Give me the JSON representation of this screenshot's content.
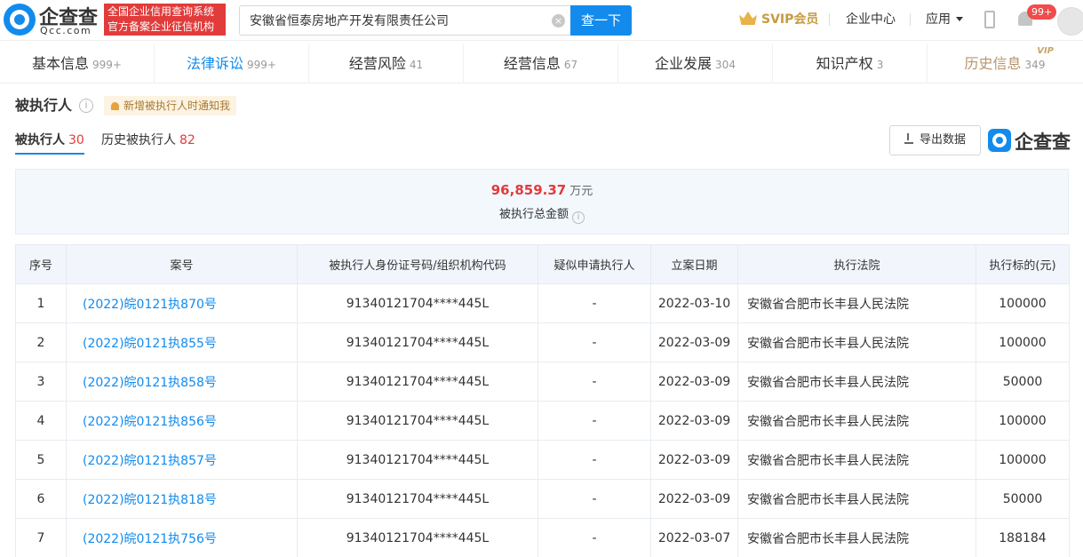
{
  "header": {
    "logo_cn": "企查查",
    "logo_en": "Qcc.com",
    "badge_line1": "全国企业信用查询系统",
    "badge_line2": "官方备案企业征信机构",
    "search_value": "安徽省恒泰房地产开发有限责任公司",
    "search_button": "查一下",
    "svip": "SVIP会员",
    "enterprise_center": "企业中心",
    "apps": "应用",
    "notification_count": "99+"
  },
  "tabs": [
    {
      "label": "基本信息",
      "count": "999+"
    },
    {
      "label": "法律诉讼",
      "count": "999+"
    },
    {
      "label": "经营风险",
      "count": "41"
    },
    {
      "label": "经营信息",
      "count": "67"
    },
    {
      "label": "企业发展",
      "count": "304"
    },
    {
      "label": "知识产权",
      "count": "3"
    },
    {
      "label": "历史信息",
      "count": "349",
      "vip": "VIP"
    }
  ],
  "section": {
    "title": "被执行人",
    "notify_label": "新增被执行人时通知我",
    "subtab_current": "被执行人",
    "subtab_current_count": "30",
    "subtab_history": "历史被执行人",
    "subtab_history_count": "82",
    "export_label": "导出数据",
    "watermark": "企查查"
  },
  "summary": {
    "amount": "96,859.37",
    "unit": "万元",
    "label": "被执行总金额"
  },
  "table": {
    "columns": [
      "序号",
      "案号",
      "被执行人身份证号码/组织机构代码",
      "疑似申请执行人",
      "立案日期",
      "执行法院",
      "执行标的(元)"
    ],
    "rows": [
      [
        "1",
        "(2022)皖0121执870号",
        "91340121704****445L",
        "-",
        "2022-03-10",
        "安徽省合肥市长丰县人民法院",
        "100000"
      ],
      [
        "2",
        "(2022)皖0121执855号",
        "91340121704****445L",
        "-",
        "2022-03-09",
        "安徽省合肥市长丰县人民法院",
        "100000"
      ],
      [
        "3",
        "(2022)皖0121执858号",
        "91340121704****445L",
        "-",
        "2022-03-09",
        "安徽省合肥市长丰县人民法院",
        "50000"
      ],
      [
        "4",
        "(2022)皖0121执856号",
        "91340121704****445L",
        "-",
        "2022-03-09",
        "安徽省合肥市长丰县人民法院",
        "100000"
      ],
      [
        "5",
        "(2022)皖0121执857号",
        "91340121704****445L",
        "-",
        "2022-03-09",
        "安徽省合肥市长丰县人民法院",
        "100000"
      ],
      [
        "6",
        "(2022)皖0121执818号",
        "91340121704****445L",
        "-",
        "2022-03-09",
        "安徽省合肥市长丰县人民法院",
        "50000"
      ],
      [
        "7",
        "(2022)皖0121执756号",
        "91340121704****445L",
        "-",
        "2022-03-07",
        "安徽省合肥市长丰县人民法院",
        "188184"
      ]
    ]
  },
  "colors": {
    "brand_blue": "#128bed",
    "accent_red": "#e23b3b",
    "vip_gold": "#c79b3f"
  }
}
